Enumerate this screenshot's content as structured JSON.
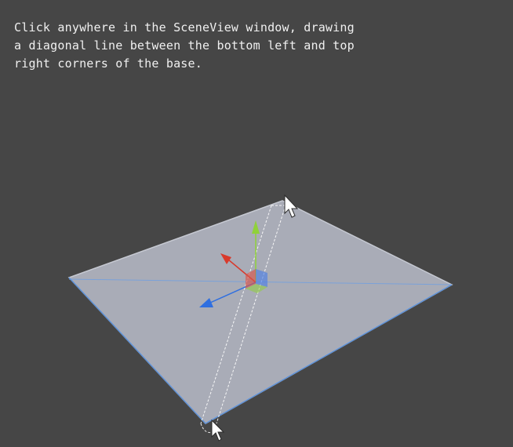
{
  "window": {
    "title": "SceneView"
  },
  "instructions": {
    "text": "Click anywhere in the SceneView window, drawing a diagonal line between the bottom left and top right corners of the base."
  },
  "scene": {
    "object": "base",
    "gizmo_axes": [
      "y-axis",
      "x-axis",
      "z-axis"
    ],
    "colors": {
      "background": "#464646",
      "plane_fill": "#a9acb7",
      "plane_edge": "#5b90d8",
      "y_axis": "#90d13a",
      "x_axis": "#d83a2c",
      "z_axis": "#2f6fe0",
      "cursor": "#ffffff"
    }
  }
}
